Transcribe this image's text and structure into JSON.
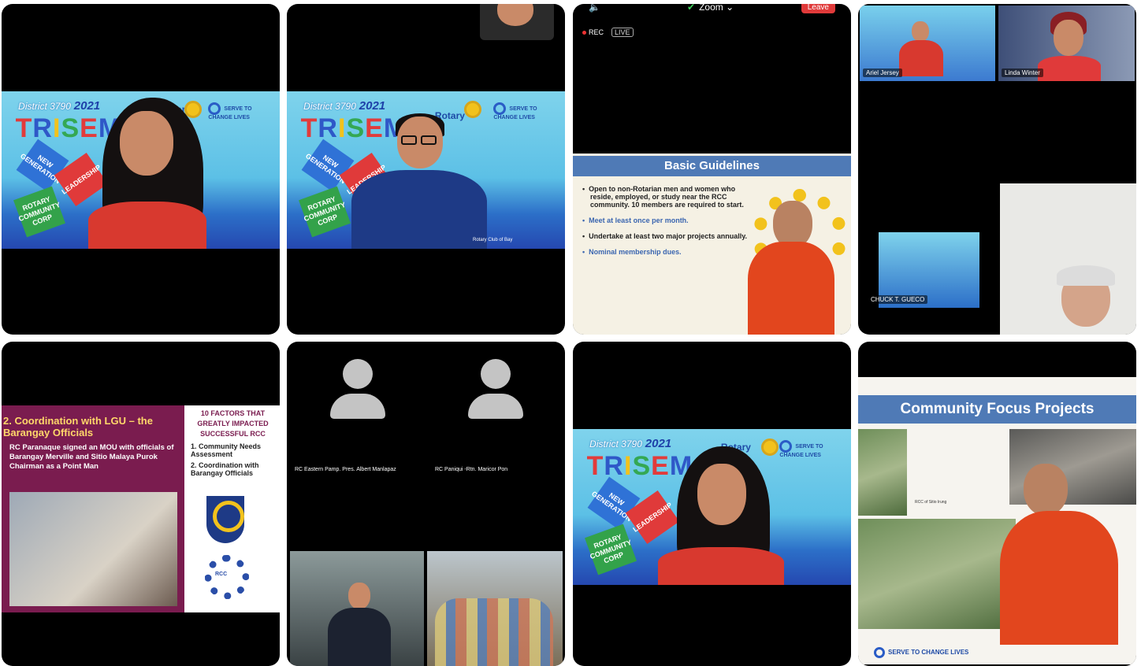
{
  "banner": {
    "district": "District 3790",
    "year": "2021",
    "trisem": [
      "T",
      "R",
      "I",
      "S",
      "E",
      "M"
    ],
    "rotary": "Rotary",
    "serve": "SERVE TO CHANGE LIVES",
    "card_new": "NEW GENERATION",
    "card_leadership": "LEADERSHIP",
    "card_rcc": "ROTARY COMMUNITY CORP"
  },
  "tile2": {
    "caption": "Rotary Club of Bay"
  },
  "tile3": {
    "rec": "REC",
    "live": "LIVE",
    "zoom": "Zoom",
    "leave": "Leave",
    "slide_title": "Basic Guidelines",
    "bullets": [
      "Open to non-Rotarian men and women who reside, employed, or study near the RCC community. 10 members are required to start.",
      "Meet at least once per month.",
      "Undertake at least two major projects annually.",
      "Nominal membership dues."
    ]
  },
  "tile4": {
    "p1": "Ariel Jersey",
    "p2": "Linda Winter",
    "p3": "CHUCK T. GUECO"
  },
  "tile5": {
    "title": "2. Coordination with LGU – the Barangay Officials",
    "body": "RC Paranaque signed an MOU with officials of Barangay Merville and Sitio Malaya Purok Chairman as a Point Man",
    "right_title": "10 FACTORS THAT GREATLY IMPACTED SUCCESSFUL RCC",
    "items": [
      "1.  Community Needs Assessment",
      "2.  Coordination with Barangay Officials"
    ],
    "rcc": "RCC"
  },
  "tile6": {
    "p1": "RC Eastern Pamp. Pres. Albert Manlapaz",
    "p2": "RC Paniqui -Rtn. Maricor Pon"
  },
  "tile8": {
    "title": "Community Focus Projects",
    "caption": "RCC of Sitio Irung",
    "footer": "SERVE TO CHANGE LIVES"
  }
}
